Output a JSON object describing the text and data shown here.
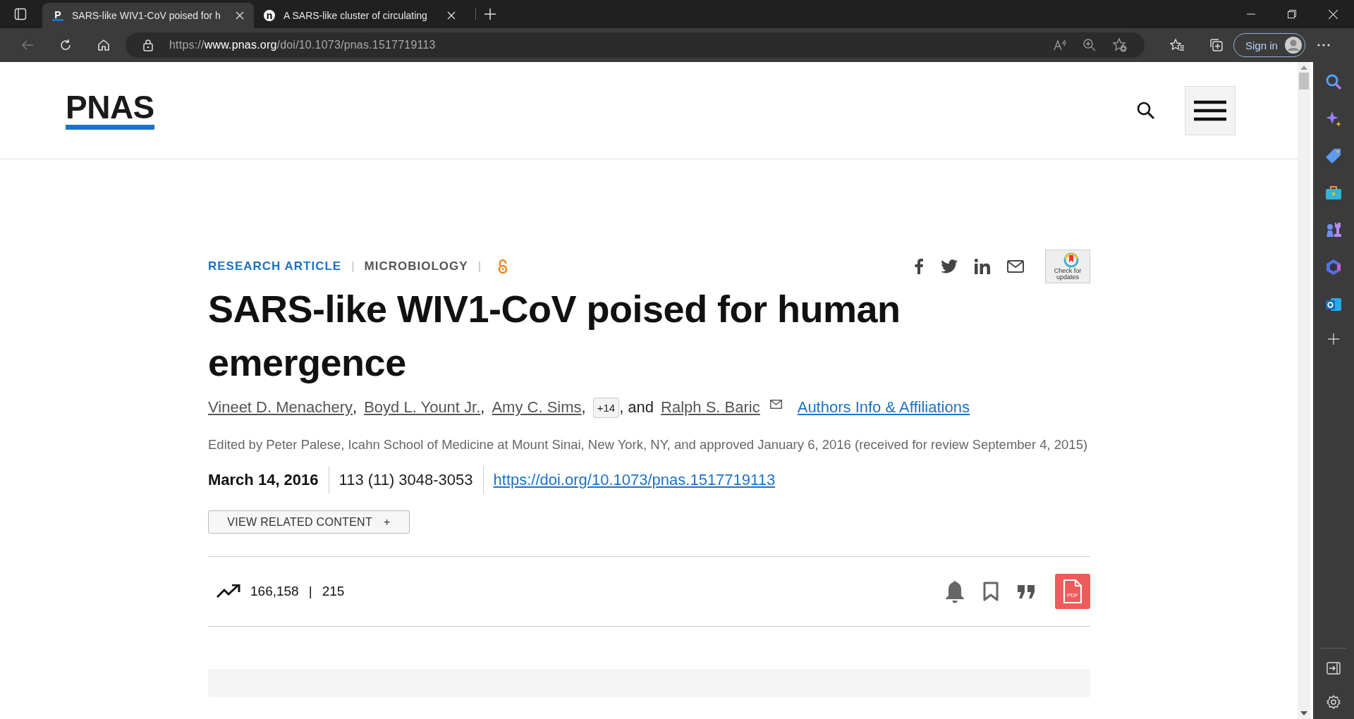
{
  "tabs": [
    {
      "title": "SARS-like WIV1-CoV poised for h",
      "favicon": "P",
      "selected": true
    },
    {
      "title": "A SARS-like cluster of circulating",
      "favicon": "n",
      "selected": false
    }
  ],
  "address": {
    "scheme": "https://",
    "host": "www.pnas.org",
    "path": "/doi/10.1073/pnas.1517719113"
  },
  "sign_in": "Sign in",
  "site": {
    "logo": "PNAS"
  },
  "article": {
    "type": "RESEARCH ARTICLE",
    "subject": "MICROBIOLOGY",
    "check_updates": "Check for updates",
    "title": "SARS-like WIV1-CoV poised for human emergence",
    "byline": [
      {
        "kind": "author",
        "text": "Vineet D. Menachery"
      },
      {
        "kind": "text",
        "text": ","
      },
      {
        "kind": "author",
        "text": "Boyd L. Yount Jr."
      },
      {
        "kind": "text",
        "text": ","
      },
      {
        "kind": "author",
        "text": "Amy C. Sims"
      },
      {
        "kind": "text",
        "text": ","
      },
      {
        "kind": "badge",
        "text": "+14"
      },
      {
        "kind": "text",
        "text": ", and"
      },
      {
        "kind": "author",
        "text": "Ralph S. Baric"
      },
      {
        "kind": "mail"
      }
    ],
    "affiliations_link": "Authors Info & Affiliations",
    "edited": "Edited by Peter Palese, Icahn School of Medicine at Mount Sinai, New York, NY, and approved January 6, 2016 (received for review September 4, 2015)",
    "date": "March 14, 2016",
    "citation": "113 (11) 3048-3053",
    "doi": "https://doi.org/10.1073/pnas.1517719113",
    "meta_sep": "|",
    "pdf_label": "PDF",
    "related_button": "VIEW RELATED CONTENT",
    "related_plus": "+",
    "views": "166,158",
    "metrics_sep": "|",
    "citations": "215"
  }
}
